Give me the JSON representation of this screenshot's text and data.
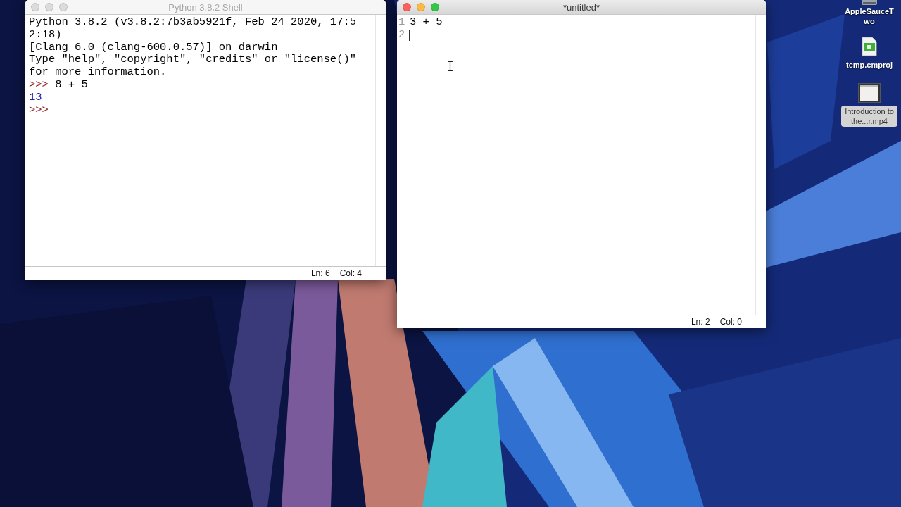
{
  "shell": {
    "title": "Python 3.8.2 Shell",
    "active": false,
    "lines": [
      {
        "kind": "output",
        "text": "Python 3.8.2 (v3.8.2:7b3ab5921f, Feb 24 2020, 17:5"
      },
      {
        "kind": "output",
        "text": "2:18)"
      },
      {
        "kind": "output",
        "text": "[Clang 6.0 (clang-600.0.57)] on darwin"
      },
      {
        "kind": "output",
        "text": "Type \"help\", \"copyright\", \"credits\" or \"license()\""
      },
      {
        "kind": "output",
        "text": "for more information."
      },
      {
        "kind": "input",
        "prompt": ">>>",
        "text": "8 + 5"
      },
      {
        "kind": "result",
        "text": "13"
      },
      {
        "kind": "input",
        "prompt": ">>>"
      }
    ],
    "status": {
      "line": "Ln: 6",
      "column": "Col: 4"
    }
  },
  "editor": {
    "title": "*untitled*",
    "active": true,
    "lines": [
      {
        "number": "1",
        "code": "3 + 5"
      },
      {
        "number": "2",
        "cursor": true
      }
    ],
    "status": {
      "line": "Ln: 2",
      "column": "Col: 0"
    }
  },
  "desktop_icons": [
    {
      "kind": "drive",
      "label": "AppleSauceTwo",
      "selected": false
    },
    {
      "kind": "file",
      "label": "temp.cmproj",
      "selected": false
    },
    {
      "kind": "video",
      "label": "Introduction to the...r.mp4",
      "selected": true
    }
  ]
}
